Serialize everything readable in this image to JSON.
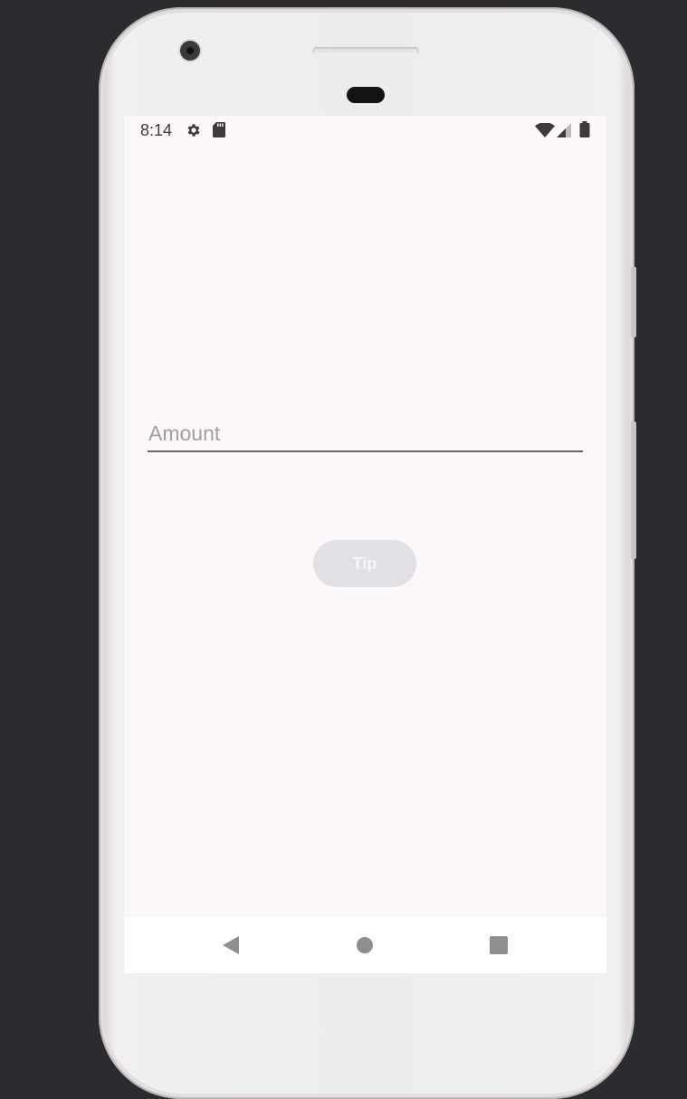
{
  "status_bar": {
    "time": "8:14",
    "left_icons": [
      "settings-icon",
      "sd-card-icon"
    ],
    "right_icons": [
      "wifi-icon",
      "cell-signal-icon",
      "battery-icon"
    ]
  },
  "form": {
    "amount_placeholder": "Amount",
    "tip_button_label": "Tip"
  },
  "nav_bar": {
    "buttons": [
      "back-icon",
      "home-icon",
      "recents-icon"
    ]
  },
  "colors": {
    "screen_background": "#fdf7fc",
    "button_background": "#e3e0e5",
    "placeholder_text": "#a39ea4",
    "field_underline": "#6a646c",
    "nav_icon": "#8e8e8e"
  }
}
